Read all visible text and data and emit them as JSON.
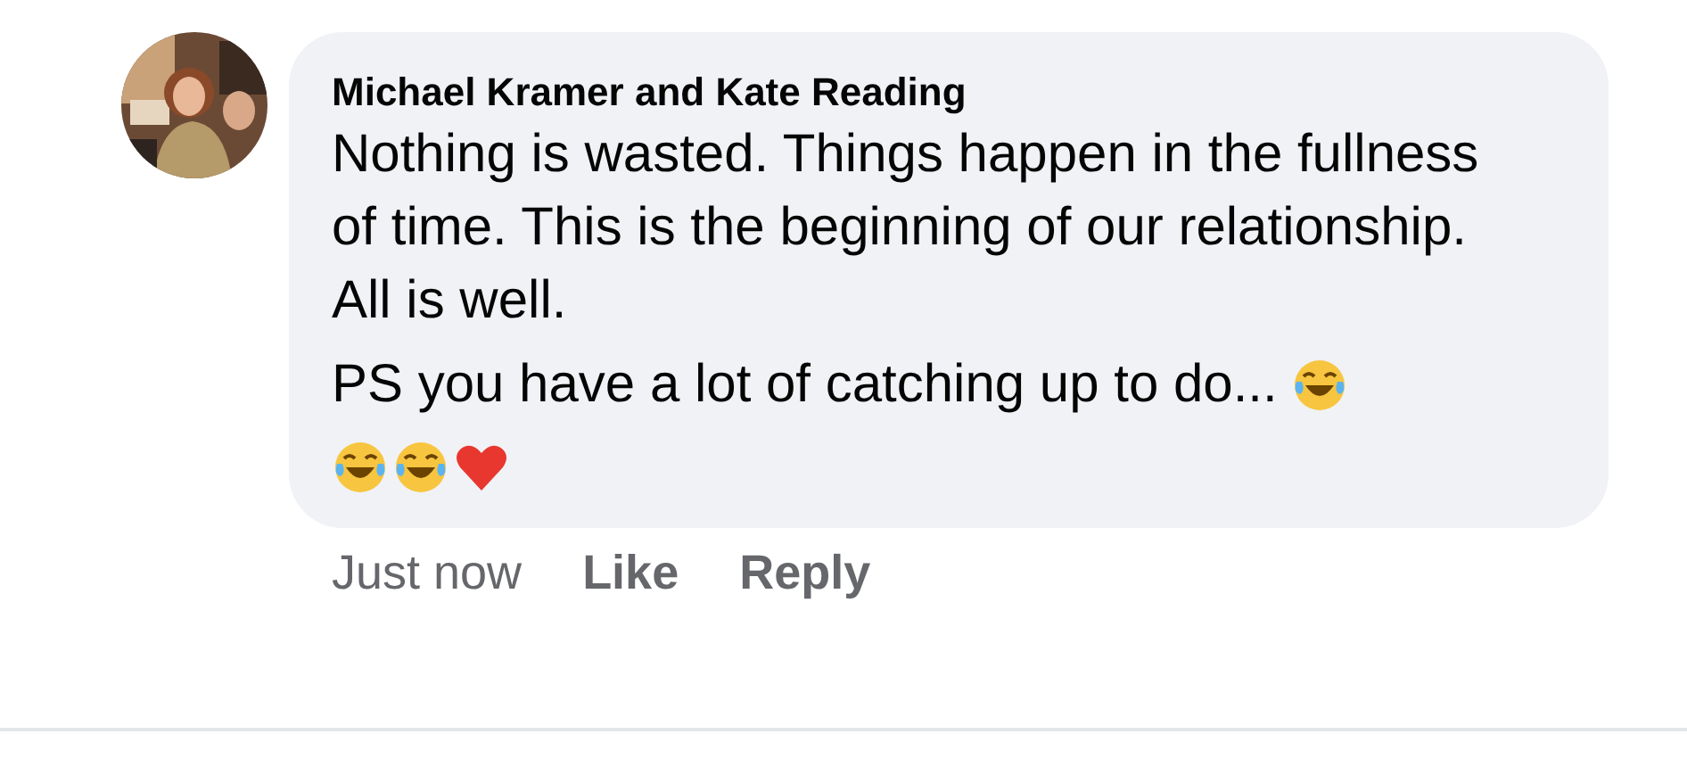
{
  "comment": {
    "author": "Michael Kramer and Kate Reading",
    "message": "Nothing is wasted. Things happen in the fullness of time. This is the beginning of our relationship. All is well.",
    "ps": {
      "text": "PS you have a lot of catching up to do...",
      "emojis": [
        {
          "kind": "laughing"
        }
      ]
    },
    "emoji_line": [
      {
        "kind": "laughing"
      },
      {
        "kind": "laughing"
      },
      {
        "kind": "heart"
      }
    ],
    "time": "Just now",
    "actions": [
      "Like",
      "Reply"
    ]
  }
}
